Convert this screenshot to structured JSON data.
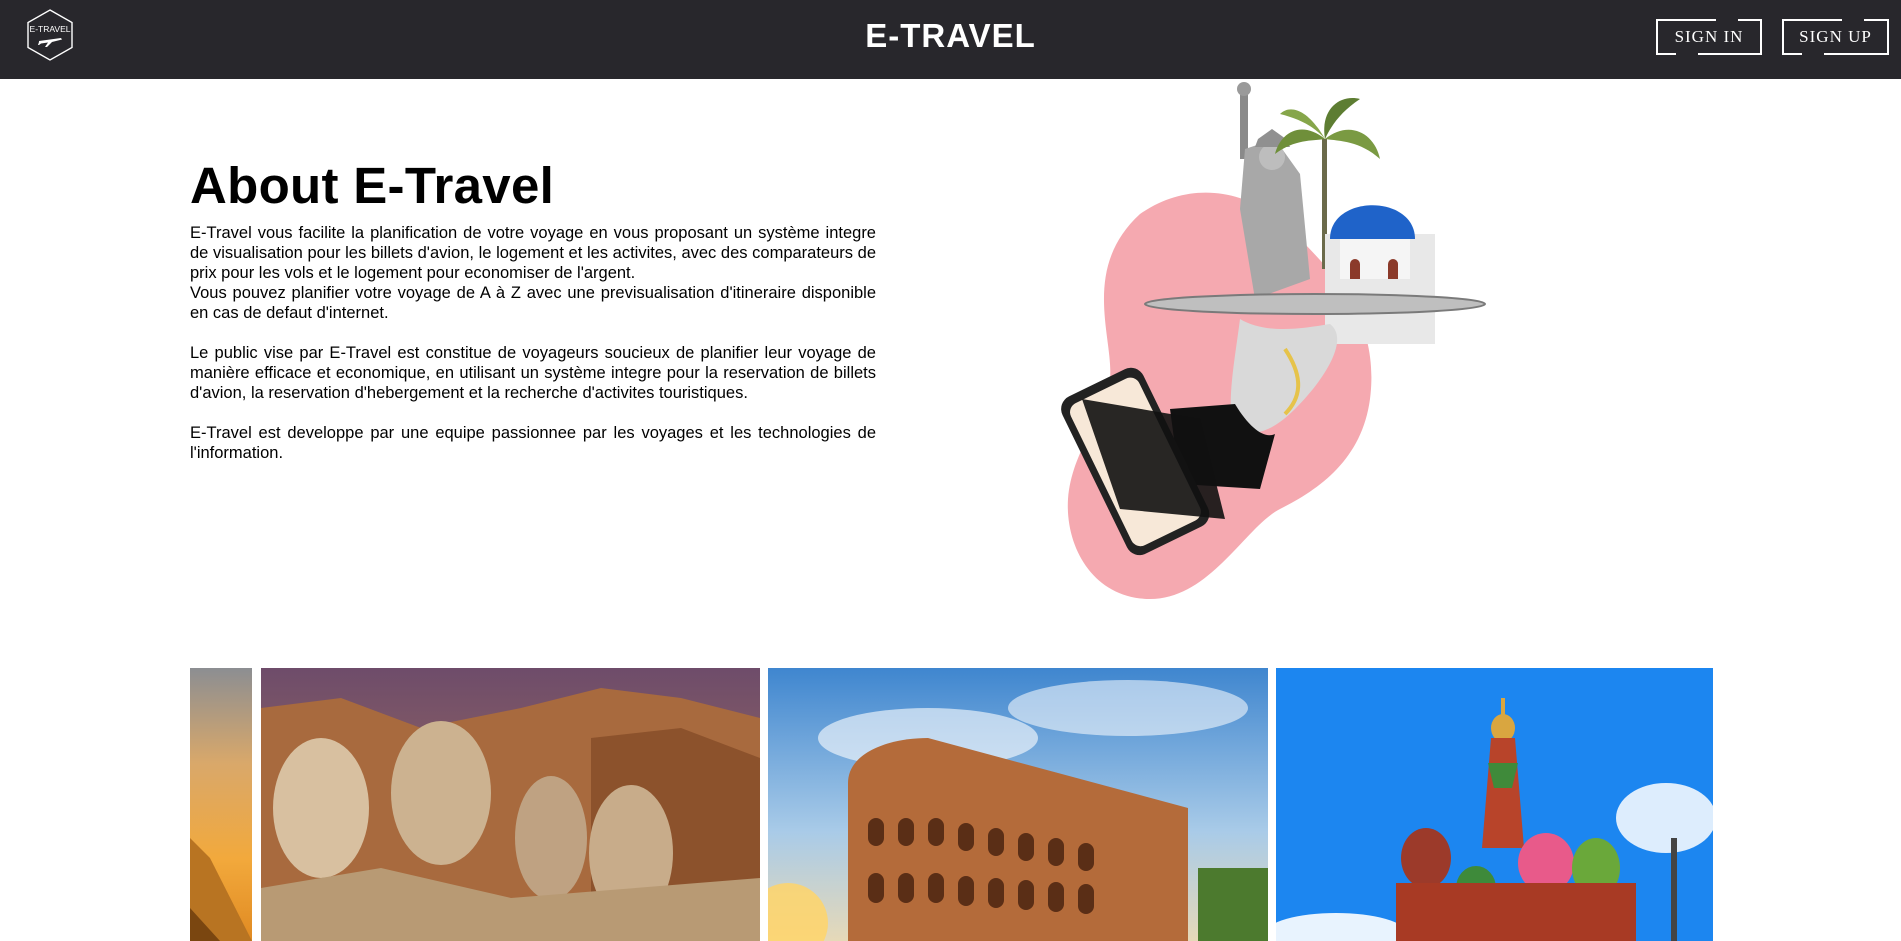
{
  "header": {
    "logo_text": "E-TRAVEL",
    "brand": "E-TRAVEL",
    "signin_label": "SIGN IN",
    "signup_label": "SIGN UP"
  },
  "about": {
    "title": "About E-Travel",
    "paragraph1_line1": "E-Travel vous facilite la planification de votre voyage en vous proposant un système integre de visualisation pour les billets d'avion, le logement et les activites, avec des comparateurs de prix pour les vols et le logement pour economiser de l'argent.",
    "paragraph1_line2": "Vous pouvez planifier votre voyage de A à Z avec une previsualisation d'itineraire disponible en cas de defaut d'internet.",
    "paragraph2": "Le public vise par E-Travel est constitue de voyageurs soucieux de planifier leur voyage de manière efficace et economique, en utilisant un système integre pour la reservation de billets d'avion, la reservation d'hebergement et la recherche d'activites touristiques.",
    "paragraph3": "E-Travel est developpe par une equipe passionnee par les voyages et les technologies de l'information."
  },
  "gallery": {
    "images": [
      "pyramids",
      "mount-rushmore",
      "colosseum",
      "saint-basils-cathedral"
    ]
  },
  "colors": {
    "navbar": "#28272c",
    "blob": "#f5a9b0"
  }
}
